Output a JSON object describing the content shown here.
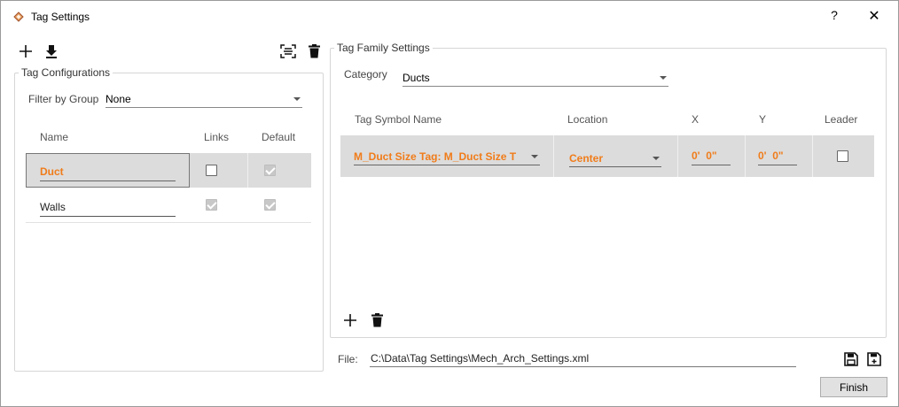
{
  "window": {
    "title": "Tag Settings",
    "help": "?",
    "close": "✕"
  },
  "tag_configurations": {
    "legend": "Tag Configurations",
    "filter_label": "Filter by Group",
    "filter_value": "None",
    "columns": {
      "name": "Name",
      "links": "Links",
      "default": "Default"
    },
    "rows": [
      {
        "name": "Duct",
        "links": false,
        "default": true,
        "selected": true
      },
      {
        "name": "Walls",
        "links": true,
        "default": true,
        "selected": false
      }
    ]
  },
  "tag_family_settings": {
    "legend": "Tag Family Settings",
    "category_label": "Category",
    "category_value": "Ducts",
    "columns": {
      "symbol": "Tag Symbol Name",
      "location": "Location",
      "x": "X",
      "y": "Y",
      "leader": "Leader"
    },
    "rows": [
      {
        "symbol": "M_Duct Size Tag: M_Duct Size T",
        "location": "Center",
        "x": "0'  0\"",
        "y": "0'  0\"",
        "leader": false
      }
    ]
  },
  "file": {
    "label": "File:",
    "path": "C:\\Data\\Tag Settings\\Mech_Arch_Settings.xml"
  },
  "buttons": {
    "finish": "Finish"
  },
  "colors": {
    "accent_orange": "#f07c1a",
    "selected_row": "#dcdcdc"
  }
}
